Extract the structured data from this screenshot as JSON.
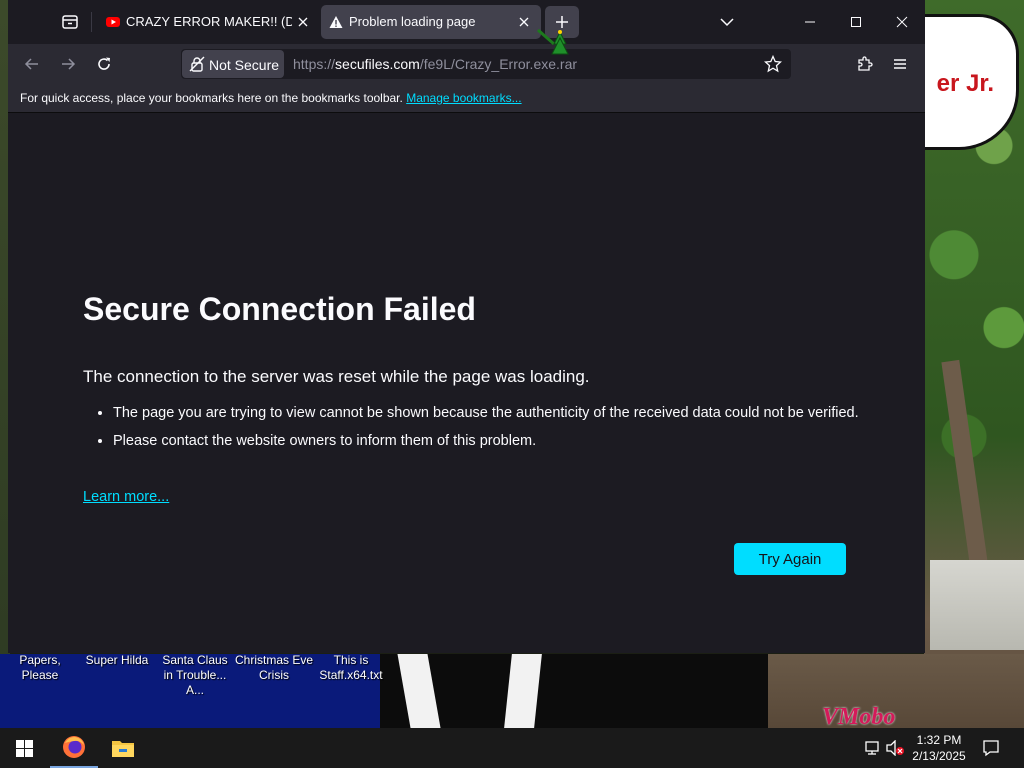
{
  "desktop": {
    "wallpaper_text": "er Jr.",
    "wallpaper_mark": "VMobo",
    "icons": [
      {
        "label": "Papers, Please"
      },
      {
        "label": "Super Hilda"
      },
      {
        "label": "Santa Claus in Trouble... A..."
      },
      {
        "label": "Christmas Eve Crisis"
      },
      {
        "label": "This is Staff.x64.txt"
      }
    ]
  },
  "browser": {
    "tabs": [
      {
        "title": "CRAZY ERROR MAKER!! (DOWNLOAD",
        "icon": "youtube-icon",
        "active": false
      },
      {
        "title": "Problem loading page",
        "icon": "warning-icon",
        "active": true
      }
    ],
    "newtab_symbol": "+",
    "nav": {
      "not_secure_label": "Not Secure",
      "url_prefix": "https://",
      "url_host": "secufiles.com",
      "url_path": "/fe9L/Crazy_Error.exe.rar"
    },
    "bookmarks_bar": {
      "message": "For quick access, place your bookmarks here on the bookmarks toolbar.",
      "link": "Manage bookmarks..."
    },
    "error": {
      "title": "Secure Connection Failed",
      "intro": "The connection to the server was reset while the page was loading.",
      "bullets": [
        "The page you are trying to view cannot be shown because the authenticity of the received data could not be verified.",
        "Please contact the website owners to inform them of this problem."
      ],
      "learn_more": "Learn more...",
      "try_again": "Try Again"
    },
    "colors": {
      "page_bg": "#1c1b22",
      "toolbar_bg": "#2b2a33",
      "accent": "#00ddff",
      "text": "#fbfbfe"
    }
  },
  "taskbar": {
    "time": "1:32 PM",
    "date": "2/13/2025",
    "apps": [
      "firefox-icon",
      "file-explorer-icon"
    ]
  }
}
